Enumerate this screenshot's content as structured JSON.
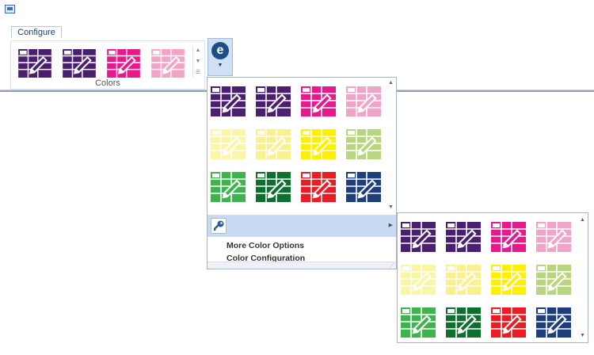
{
  "app": {
    "icon": "window-app-icon"
  },
  "tabs": [
    {
      "label": "Configure"
    }
  ],
  "ribbon": {
    "group_label": "Colors",
    "gallery_colors": [
      "#4a1f6e",
      "#4a1f6e",
      "#e8198b",
      "#f2a4c7"
    ],
    "big_button_icon": "e-icon",
    "big_button_glyph": "e"
  },
  "menu": {
    "colors": [
      "#4a1f6e",
      "#4a1f6e",
      "#e8198b",
      "#f2a4c7",
      "#fbf6a6",
      "#f9f08f",
      "#fff000",
      "#b8d680",
      "#3fb34f",
      "#0e6f31",
      "#ec1c24",
      "#1f3f7a"
    ],
    "key_icon": "key-icon",
    "items": [
      {
        "label": "More Color Options"
      },
      {
        "label": "Color Configuration"
      }
    ]
  },
  "submenu": {
    "colors": [
      "#4a1f6e",
      "#4a1f6e",
      "#e8198b",
      "#f2a4c7",
      "#fbf6a6",
      "#f9f08f",
      "#fff000",
      "#b8d680",
      "#3fb34f",
      "#0e6f31",
      "#ec1c24",
      "#1f3f7a"
    ]
  }
}
